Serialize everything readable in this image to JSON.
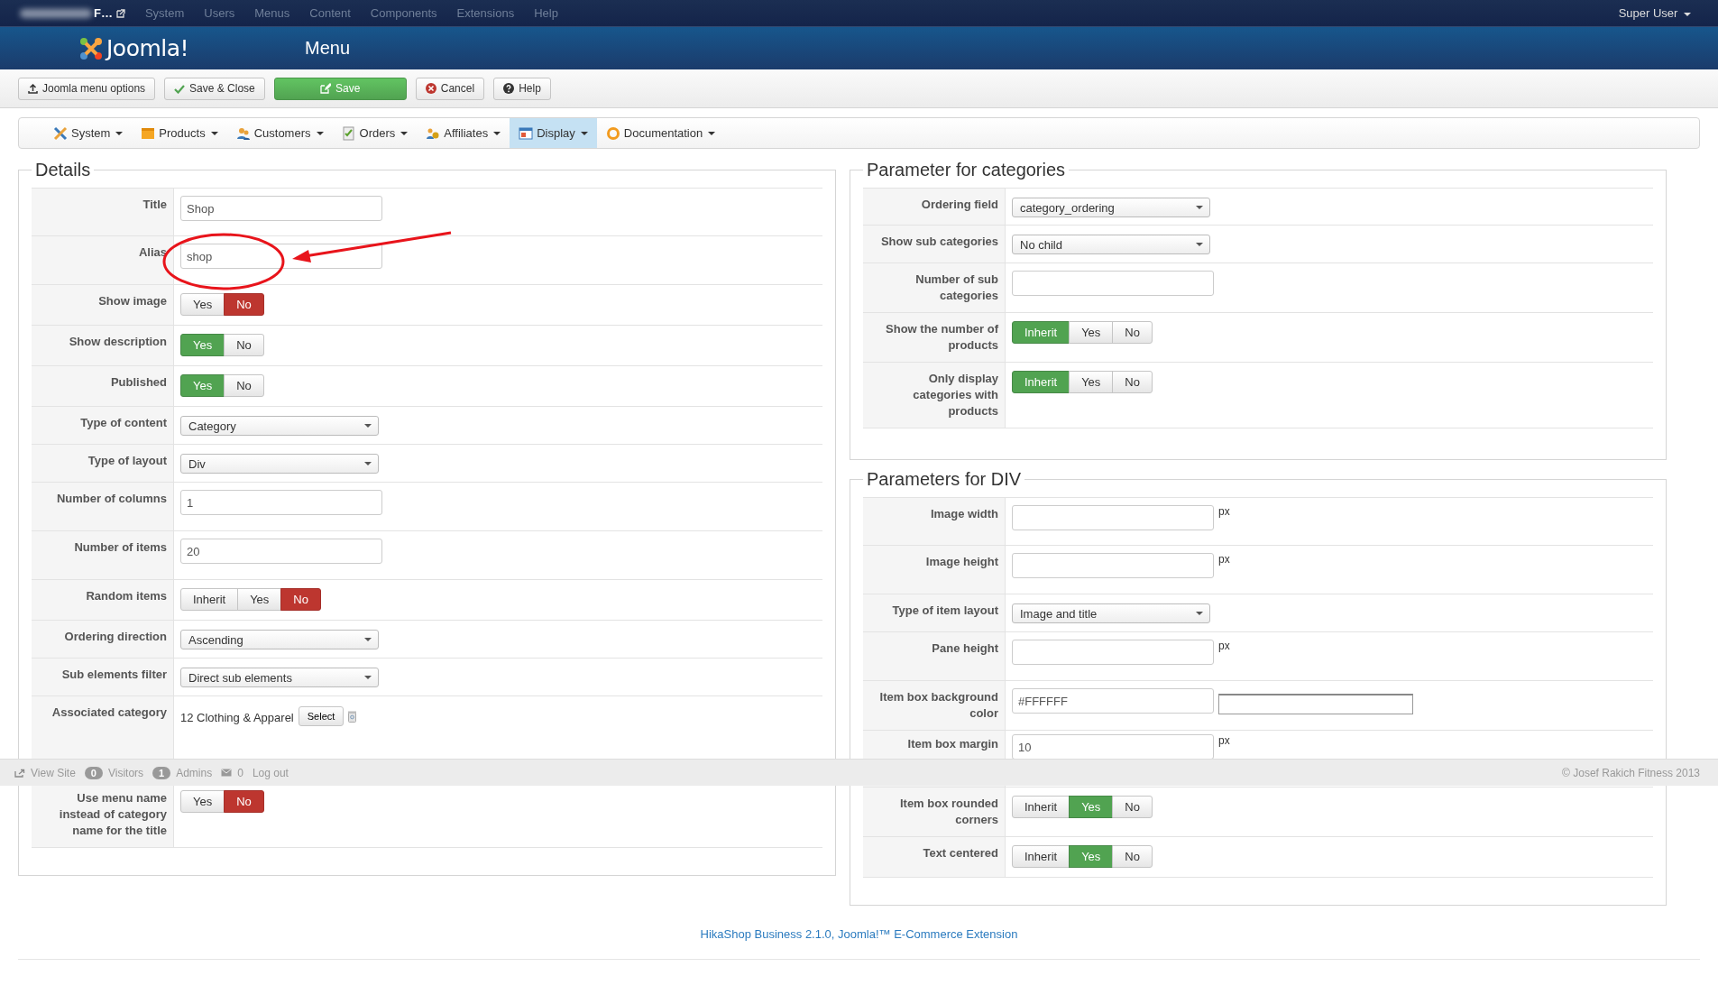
{
  "top_menu": {
    "site_name": "F…",
    "items": [
      {
        "label": "System",
        "disabled": true
      },
      {
        "label": "Users",
        "disabled": true
      },
      {
        "label": "Menus",
        "disabled": true
      },
      {
        "label": "Content",
        "disabled": true
      },
      {
        "label": "Components",
        "disabled": true
      },
      {
        "label": "Extensions",
        "disabled": true
      },
      {
        "label": "Help",
        "disabled": true
      }
    ],
    "user": "Super User"
  },
  "header": {
    "logo": "Joomla!",
    "title": "Menu"
  },
  "toolbar": [
    {
      "label": "Joomla menu options",
      "kind": "upload"
    },
    {
      "label": "Save & Close",
      "kind": "check"
    },
    {
      "label": "Save",
      "kind": "save"
    },
    {
      "label": "Cancel",
      "kind": "cancel"
    },
    {
      "label": "Help",
      "kind": "help"
    }
  ],
  "submenu": [
    {
      "label": "System",
      "kind": "system",
      "selected": false
    },
    {
      "label": "Products",
      "kind": "products",
      "selected": false
    },
    {
      "label": "Customers",
      "kind": "customers",
      "selected": false
    },
    {
      "label": "Orders",
      "kind": "orders",
      "selected": false
    },
    {
      "label": "Affiliates",
      "kind": "affiliates",
      "selected": false
    },
    {
      "label": "Display",
      "kind": "display",
      "selected": true
    },
    {
      "label": "Documentation",
      "kind": "documentation",
      "selected": false
    }
  ],
  "details": {
    "title": "Details",
    "rows": [
      {
        "label": "Title",
        "kind": "text",
        "value": "Shop"
      },
      {
        "label": "Alias",
        "kind": "text",
        "value": "shop"
      },
      {
        "label": "Show image",
        "kind": "toggle",
        "options": [
          {
            "label": "Yes",
            "kind": "positive",
            "selected": false
          },
          {
            "label": "No",
            "kind": "negative",
            "selected": true
          }
        ]
      },
      {
        "label": "Show description",
        "kind": "toggle",
        "options": [
          {
            "label": "Yes",
            "kind": "positive",
            "selected": true
          },
          {
            "label": "No",
            "kind": "negative",
            "selected": false
          }
        ]
      },
      {
        "label": "Published",
        "kind": "toggle",
        "options": [
          {
            "label": "Yes",
            "kind": "positive",
            "selected": true
          },
          {
            "label": "No",
            "kind": "negative",
            "selected": false
          }
        ]
      },
      {
        "label": "Type of content",
        "kind": "select",
        "value": "Category"
      },
      {
        "label": "Type of layout",
        "kind": "select",
        "value": "Div"
      },
      {
        "label": "Number of columns",
        "kind": "text",
        "value": "1"
      },
      {
        "label": "Number of items",
        "kind": "text",
        "value": "20"
      },
      {
        "label": "Random items",
        "kind": "toggle",
        "options": [
          {
            "label": "Inherit",
            "kind": "positive",
            "selected": false
          },
          {
            "label": "Yes",
            "kind": "positive",
            "selected": false
          },
          {
            "label": "No",
            "kind": "negative",
            "selected": true
          }
        ]
      },
      {
        "label": "Ordering direction",
        "kind": "select",
        "value": "Ascending"
      },
      {
        "label": "Sub elements filter",
        "kind": "select",
        "value": "Direct sub elements"
      },
      {
        "label": "Associated category",
        "kind": "category",
        "value": "12 Clothing & Apparel",
        "button": "Select"
      },
      {
        "label": "Use menu name instead of category name for the title",
        "kind": "toggle",
        "options": [
          {
            "label": "Yes",
            "kind": "positive",
            "selected": false
          },
          {
            "label": "No",
            "kind": "negative",
            "selected": true
          }
        ]
      }
    ]
  },
  "categories": {
    "title": "Parameter for categories",
    "rows": [
      {
        "label": "Ordering field",
        "kind": "select",
        "value": "category_ordering"
      },
      {
        "label": "Show sub categories",
        "kind": "select",
        "value": "No child"
      },
      {
        "label": "Number of sub categories",
        "kind": "text"
      },
      {
        "label": "Show the number of products",
        "kind": "toggle",
        "options": [
          {
            "label": "Inherit",
            "kind": "positive",
            "selected": true
          },
          {
            "label": "Yes",
            "kind": "positive",
            "selected": false
          },
          {
            "label": "No",
            "kind": "negative",
            "selected": false
          }
        ]
      },
      {
        "label": "Only display categories with products",
        "kind": "toggle",
        "options": [
          {
            "label": "Inherit",
            "kind": "positive",
            "selected": true
          },
          {
            "label": "Yes",
            "kind": "positive",
            "selected": false
          },
          {
            "label": "No",
            "kind": "negative",
            "selected": false
          }
        ]
      }
    ]
  },
  "div": {
    "title": "Parameters for DIV",
    "rows": [
      {
        "label": "Image width",
        "kind": "px",
        "unit": "px"
      },
      {
        "label": "Image height",
        "kind": "px",
        "unit": "px"
      },
      {
        "label": "Type of item layout",
        "kind": "select",
        "value": "Image and title"
      },
      {
        "label": "Pane height",
        "kind": "px",
        "unit": "px"
      },
      {
        "label": "Item box background color",
        "kind": "color",
        "value": "#FFFFFF"
      },
      {
        "label": "Item box margin",
        "kind": "px",
        "value": "10",
        "unit": "px"
      },
      {
        "label": "Item box rounded corners",
        "kind": "toggle",
        "options": [
          {
            "label": "Inherit",
            "kind": "positive",
            "selected": false
          },
          {
            "label": "Yes",
            "kind": "positive",
            "selected": true
          },
          {
            "label": "No",
            "kind": "negative",
            "selected": false
          }
        ]
      },
      {
        "label": "Text centered",
        "kind": "toggle",
        "options": [
          {
            "label": "Inherit",
            "kind": "positive",
            "selected": false
          },
          {
            "label": "Yes",
            "kind": "positive",
            "selected": true
          },
          {
            "label": "No",
            "kind": "negative",
            "selected": false
          }
        ]
      }
    ]
  },
  "footer": {
    "link": "HikaShop Business 2.1.0, Joomla!™ E-Commerce Extension"
  },
  "status_bar": {
    "view_site": "View Site",
    "visitors_count": "0",
    "visitors": "Visitors",
    "admins_count": "1",
    "admins": "Admins",
    "messages_count": "0",
    "logout": "Log out",
    "copyright": "© Josef Rakich Fitness 2013"
  }
}
